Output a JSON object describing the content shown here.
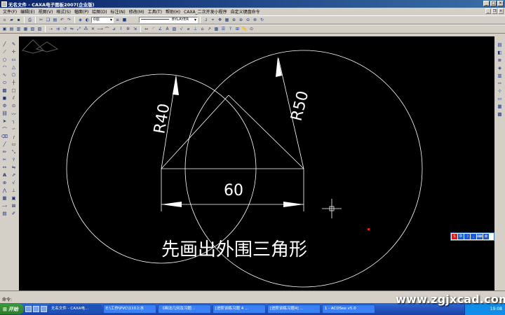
{
  "window": {
    "title": "无名文件 - CAXA电子图板2007(企业版)",
    "buttons": [
      "_",
      "□",
      "×"
    ]
  },
  "menubar": {
    "items": [
      "文件(F)",
      "编辑(E)",
      "视图(V)",
      "格式(S)",
      "幅面(P)",
      "绘图(D)",
      "标注(N)",
      "修改(M)",
      "工具(T)",
      "帮助(H)",
      "CAXA_二次开发小程序",
      "自定义键盘命令"
    ]
  },
  "toolbar1": {
    "layer_combo": "0层",
    "linetype_combo": "BYLAYER"
  },
  "drawing": {
    "radius_label_left": "R40",
    "radius_label_right": "R50",
    "dimension_label": "60",
    "instruction_text": "先画出外围三角形"
  },
  "command": {
    "prompt": "命令:",
    "status_right": "立命令:"
  },
  "taskbar": {
    "start_label": "开始",
    "tasks": [
      "无名文件 - CAXA电...",
      "E:\\工作\\PVC\\110上水",
      "《画法几何及习题...",
      "[进阶训练习题 4 ...",
      "[进阶训练习题4] ...",
      "1 - ACDSee v5.0"
    ],
    "clock": "19:08"
  },
  "site_watermark": "www.zgjxcad.com"
}
